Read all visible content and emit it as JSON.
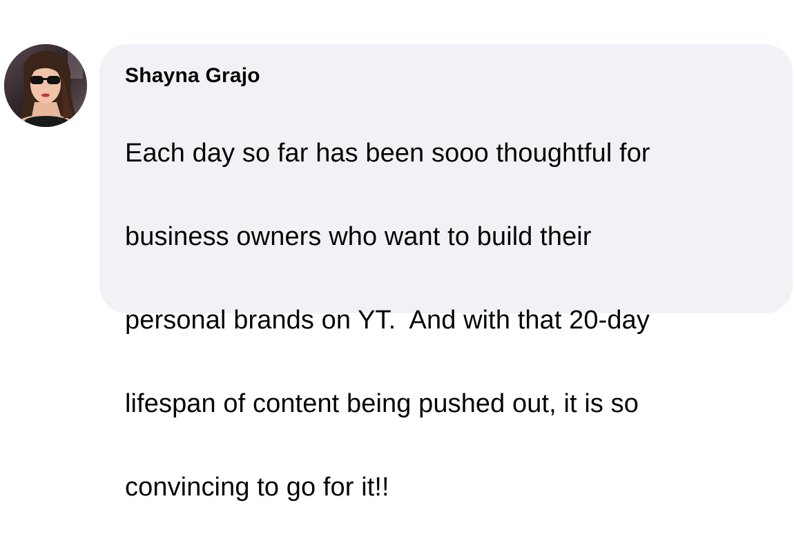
{
  "comment": {
    "author": "Shayna Grajo",
    "lines": [
      "Each day so far has been sooo thoughtful for",
      "business owners who want to build their",
      "personal brands on YT.  And with that 20-day",
      "lifespan of content being pushed out, it is so",
      "convincing to go for it!!"
    ]
  },
  "colors": {
    "bubble_background": "#f0f2f5",
    "text": "#050505"
  },
  "icons": {
    "avatar": "profile-photo"
  }
}
